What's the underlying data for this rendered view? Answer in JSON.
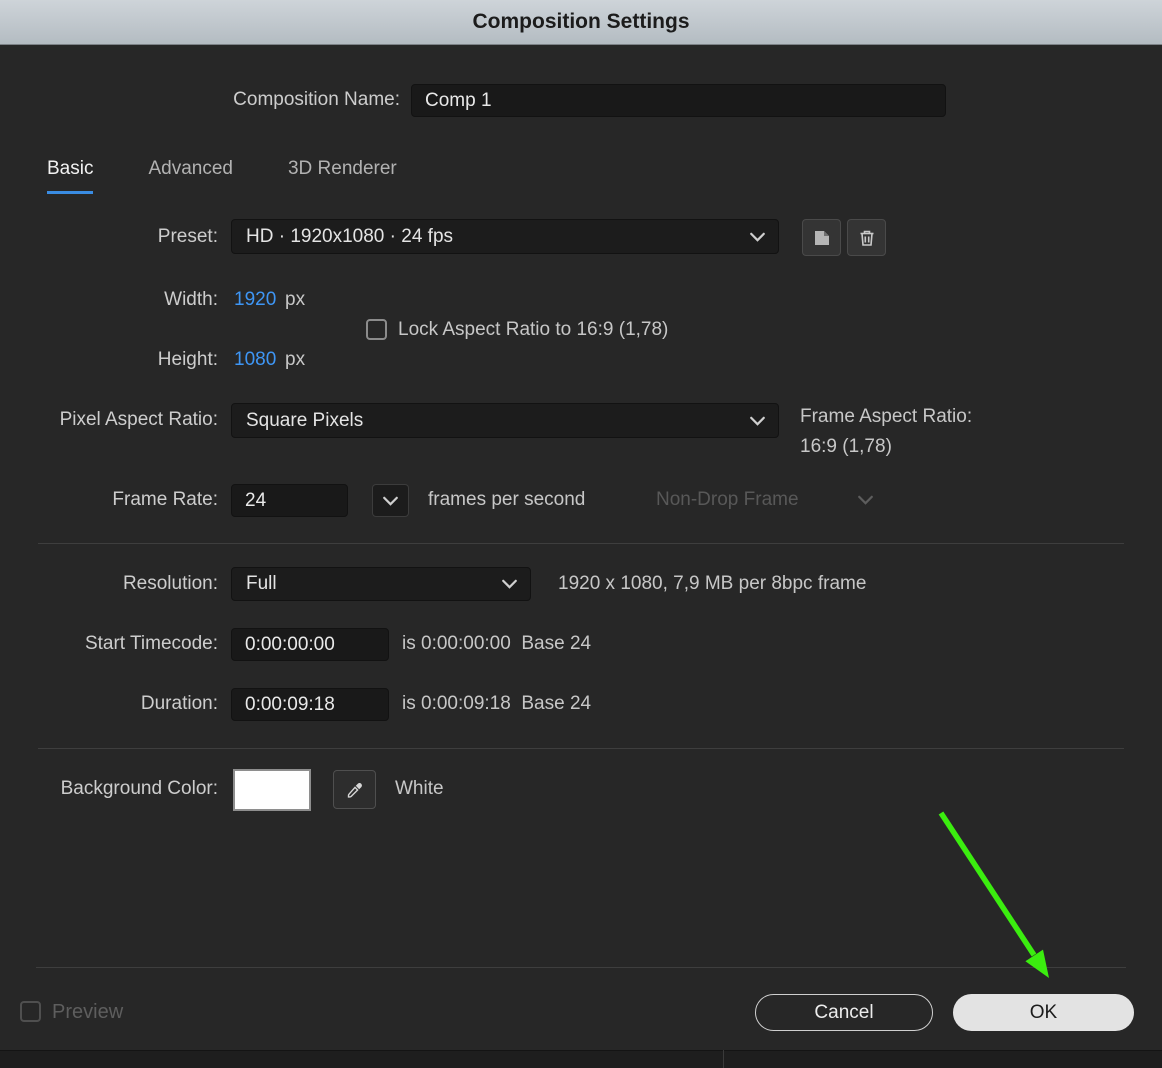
{
  "titlebar": {
    "title": "Composition Settings"
  },
  "composition_name": {
    "label": "Composition Name:",
    "value": "Comp 1"
  },
  "tabs": [
    {
      "label": "Basic",
      "active": true
    },
    {
      "label": "Advanced",
      "active": false
    },
    {
      "label": "3D Renderer",
      "active": false
    }
  ],
  "preset": {
    "label": "Preset:",
    "value": "HD · 1920x1080 · 24 fps"
  },
  "dimensions": {
    "width_label": "Width:",
    "width_value": "1920",
    "width_unit": "px",
    "height_label": "Height:",
    "height_value": "1080",
    "height_unit": "px",
    "lock_label": "Lock Aspect Ratio to 16:9 (1,78)",
    "lock_checked": false
  },
  "pixel_aspect_ratio": {
    "label": "Pixel Aspect Ratio:",
    "value": "Square Pixels"
  },
  "frame_aspect_ratio": {
    "label": "Frame Aspect Ratio:",
    "value": "16:9 (1,78)"
  },
  "frame_rate": {
    "label": "Frame Rate:",
    "value": "24",
    "suffix": "frames per second",
    "dropframe": "Non-Drop Frame"
  },
  "resolution": {
    "label": "Resolution:",
    "value": "Full",
    "info": "1920 x 1080, 7,9 MB per 8bpc frame"
  },
  "start_timecode": {
    "label": "Start Timecode:",
    "value": "0:00:00:00",
    "info": "is 0:00:00:00  Base 24"
  },
  "duration": {
    "label": "Duration:",
    "value": "0:00:09:18",
    "info": "is 0:00:09:18  Base 24"
  },
  "background_color": {
    "label": "Background Color:",
    "color_name": "White",
    "swatch_hex": "#ffffff"
  },
  "footer": {
    "preview_label": "Preview",
    "preview_checked": false,
    "cancel_label": "Cancel",
    "ok_label": "OK"
  },
  "colors": {
    "accent_blue": "#3e96f5",
    "tab_underline_blue": "#3a8ce2",
    "annotation_arrow_green": "#3bed0f",
    "background_swatch": "#ffffff"
  }
}
